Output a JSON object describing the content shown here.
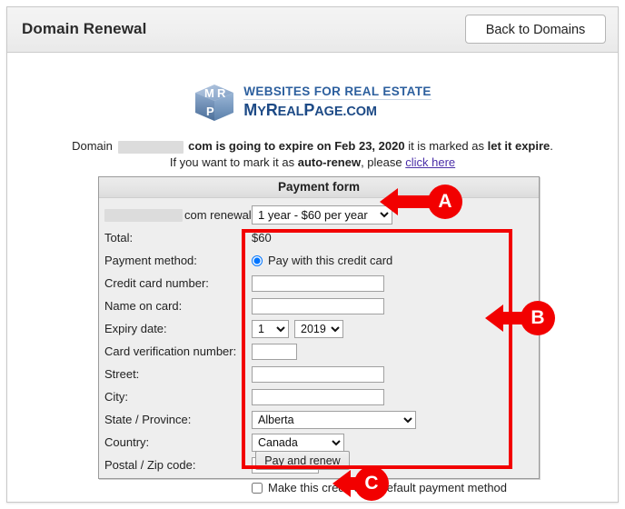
{
  "header": {
    "title": "Domain Renewal",
    "back_button": "Back to Domains"
  },
  "logo": {
    "cube_letters": "MRP",
    "tagline": "WEBSITES FOR REAL ESTATE",
    "brand_my": "M",
    "brand_y": "Y",
    "brand_real": "R",
    "brand_eal": "EAL",
    "brand_page": "P",
    "brand_age": "AGE",
    "brand_com": ".COM"
  },
  "notice": {
    "line1_part1": "Domain",
    "line1_part2": "com is going to expire on",
    "line1_date": "Feb 23, 2020",
    "line1_part3": "it is marked as",
    "line1_status": "let it expire",
    "line1_end": ".",
    "line2_part1": "If you want to mark it as",
    "line2_mode": "auto-renew",
    "line2_part2": ", please",
    "line2_link": "click here"
  },
  "payment_form": {
    "title": "Payment form",
    "renewal_label_suffix": "com renewal:",
    "renewal_term_selected": "1 year - $60 per year",
    "renewal_term_options": [
      "1 year - $60 per year"
    ],
    "total_label": "Total:",
    "total_value": "$60",
    "payment_method_label": "Payment method:",
    "payment_method_radio": "Pay with this credit card",
    "credit_card_number_label": "Credit card number:",
    "credit_card_number_value": "",
    "name_on_card_label": "Name on card:",
    "name_on_card_value": "",
    "expiry_date_label": "Expiry date:",
    "expiry_month_selected": "1",
    "expiry_month_options": [
      "1"
    ],
    "expiry_year_selected": "2019",
    "expiry_year_options": [
      "2019"
    ],
    "card_verification_label": "Card verification number:",
    "card_verification_value": "",
    "street_label": "Street:",
    "street_value": "",
    "city_label": "City:",
    "city_value": "",
    "state_label": "State / Province:",
    "state_selected": "Alberta",
    "state_options": [
      "Alberta"
    ],
    "country_label": "Country:",
    "country_selected": "Canada",
    "country_options": [
      "Canada"
    ],
    "postal_label": "Postal / Zip code:",
    "postal_value": "",
    "default_method_checkbox": "Make this credit card default payment method",
    "submit_button": "Pay and renew"
  },
  "annotations": {
    "marker_a": "A",
    "marker_b": "B",
    "marker_c": "C",
    "highlight_color": "#f20000"
  }
}
